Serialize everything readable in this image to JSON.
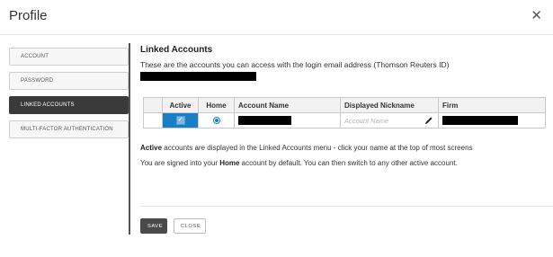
{
  "dialog": {
    "title": "Profile",
    "close_glyph": "✕"
  },
  "nav": {
    "items": [
      {
        "label": "ACCOUNT",
        "active": false
      },
      {
        "label": "PASSWORD",
        "active": false
      },
      {
        "label": "LINKED ACCOUNTS",
        "active": true
      },
      {
        "label": "MULTI-FACTOR AUTHENTICATION",
        "active": false
      }
    ]
  },
  "linked": {
    "title": "Linked Accounts",
    "description_prefix": "These are the accounts you can access with the login email address (Thomson Reuters ID)",
    "table": {
      "headers": [
        "",
        "Active",
        "Home",
        "Account Name",
        "Displayed Nickname",
        "Firm"
      ],
      "rows": [
        {
          "active": true,
          "home": true,
          "account_name": "[redacted]",
          "nickname_placeholder": "Account Name",
          "firm": "[redacted]"
        }
      ]
    },
    "note1_bold": "Active",
    "note1_rest": " accounts are displayed in the Linked Accounts menu - click your name at the top of most screens",
    "note2_pre": "You are signed into your ",
    "note2_bold": "Home",
    "note2_post": " account by default. You can then switch to any other active account."
  },
  "buttons": {
    "save": "SAVE",
    "close": "CLOSE"
  },
  "colors": {
    "accent": "#1a80c4",
    "nav_active_bg": "#3a3a3a",
    "save_bg": "#4a4a4a"
  },
  "icons": {
    "close": "close-icon",
    "check": "checkbox-check-icon",
    "radio": "radio-selected-icon",
    "pencil": "pencil-icon"
  }
}
